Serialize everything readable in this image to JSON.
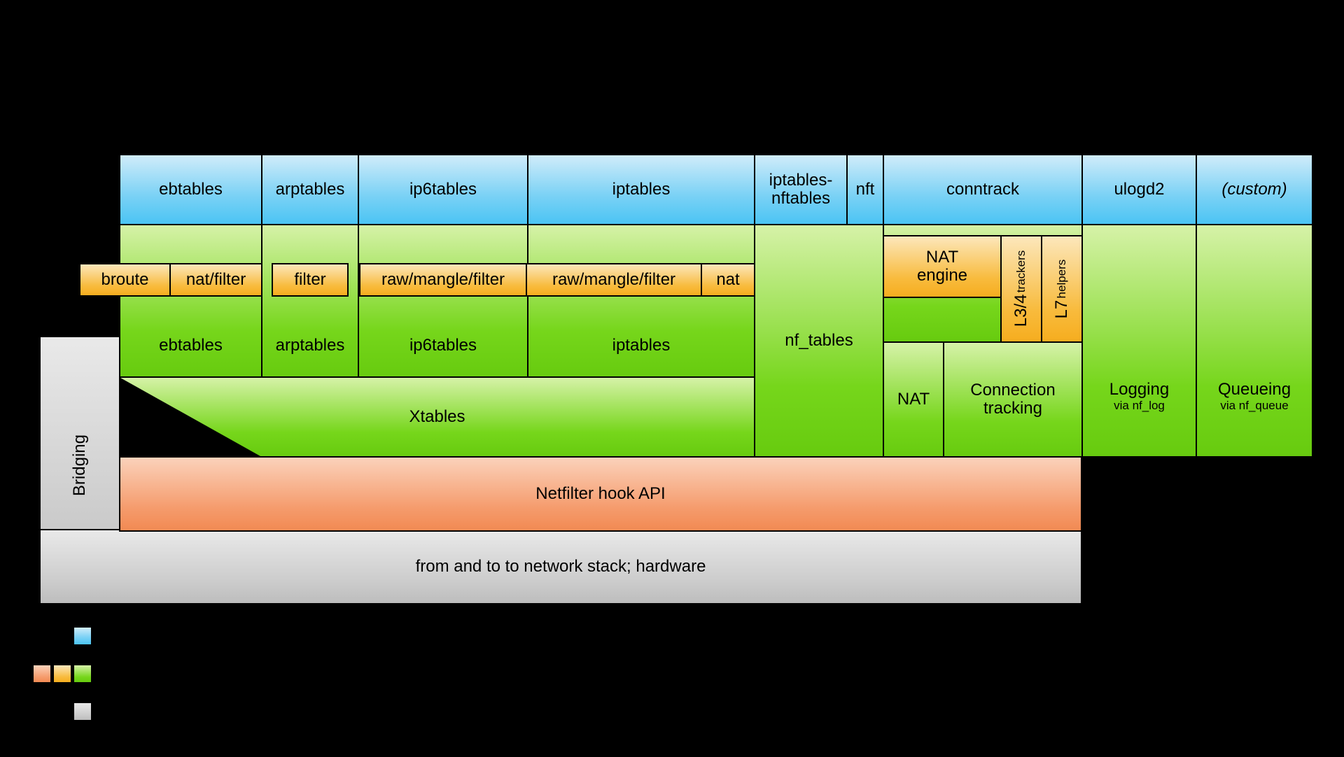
{
  "top": {
    "ebtables": "ebtables",
    "arptables": "arptables",
    "ip6tables": "ip6tables",
    "iptables": "iptables",
    "iptables_nftables_l1": "iptables-",
    "iptables_nftables_l2": "nftables",
    "nft": "nft",
    "conntrack": "conntrack",
    "ulogd2": "ulogd2",
    "custom": "(custom)"
  },
  "orange_row": {
    "broute": "broute",
    "natfilter": "nat/filter",
    "filter": "filter",
    "rmf1": "raw/mangle/filter",
    "rmf2": "raw/mangle/filter",
    "nat": "nat",
    "nat_engine_l1": "NAT",
    "nat_engine_l2": "engine",
    "l34": "L3/4",
    "l34_sub": "trackers",
    "l7": "L7",
    "l7_sub": "helpers"
  },
  "green_row2": {
    "ebtables": "ebtables",
    "arptables": "arptables",
    "ip6tables": "ip6tables",
    "iptables": "iptables"
  },
  "xtables": "Xtables",
  "right": {
    "nf_tables": "nf_tables",
    "nat": "NAT",
    "conntrack_l1": "Connection",
    "conntrack_l2": "tracking",
    "logging_l1": "Logging",
    "logging_l2": "via nf_log",
    "queue_l1": "Queueing",
    "queue_l2": "via nf_queue"
  },
  "hook": "Netfilter hook API",
  "stack": "from and to to network stack; hardware",
  "bridging": "Bridging"
}
